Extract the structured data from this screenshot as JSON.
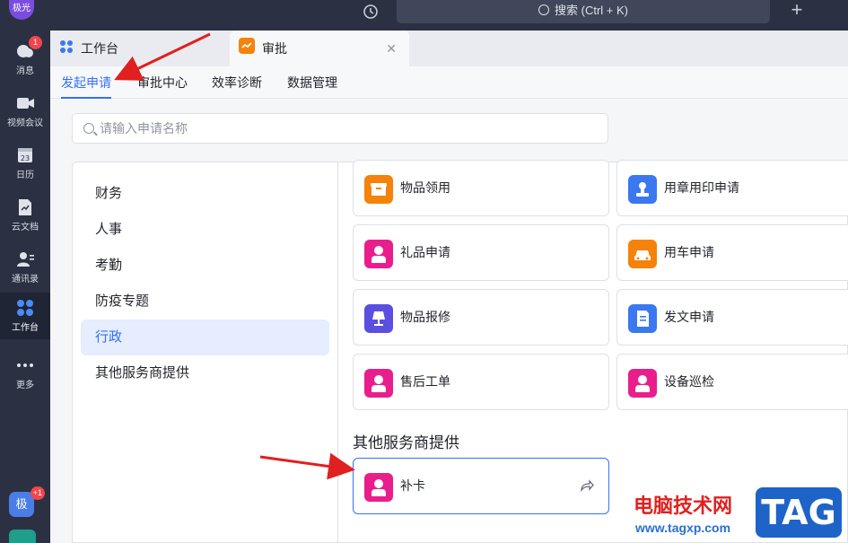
{
  "rail": {
    "top_avatar": "极光",
    "items": [
      {
        "label": "消息",
        "badge": "1",
        "icon": "chat-bubble-icon"
      },
      {
        "label": "视频会议",
        "icon": "video-camera-icon"
      },
      {
        "label": "日历",
        "day": "23",
        "icon": "calendar-icon"
      },
      {
        "label": "云文档",
        "icon": "cloud-document-icon"
      },
      {
        "label": "通讯录",
        "icon": "contacts-icon"
      },
      {
        "label": "工作台",
        "icon": "workbench-grid-icon"
      },
      {
        "label": "更多",
        "icon": "more-dots-icon"
      }
    ],
    "bottom_avatar": "极",
    "bottom_badge": "+1"
  },
  "titlebar": {
    "search_text": "搜索 (Ctrl + K)"
  },
  "tabs": [
    {
      "label": "工作台"
    },
    {
      "label": "审批"
    }
  ],
  "subnav": [
    "发起申请",
    "审批中心",
    "效率诊断",
    "数据管理"
  ],
  "search": {
    "placeholder": "请输入申请名称"
  },
  "categories": [
    "财务",
    "人事",
    "考勤",
    "防疫专题",
    "行政",
    "其他服务商提供"
  ],
  "cards": [
    {
      "label": "物品领用",
      "color": "#f5820a"
    },
    {
      "label": "用章用印申请",
      "color": "#3b78f0"
    },
    {
      "label": "礼品申请",
      "color": "#e91e8c"
    },
    {
      "label": "用车申请",
      "color": "#f5820a"
    },
    {
      "label": "物品报修",
      "color": "#5a4fe0"
    },
    {
      "label": "发文申请",
      "color": "#3b78f0"
    },
    {
      "label": "售后工单",
      "color": "#e91e8c"
    },
    {
      "label": "设备巡检",
      "color": "#e91e8c"
    }
  ],
  "other_section": {
    "title": "其他服务商提供",
    "card": {
      "label": "补卡",
      "color": "#e91e8c"
    }
  },
  "watermark": {
    "text": "电脑技术网",
    "url": "www.tagxp.com",
    "logo": "TAG"
  },
  "accent": "#3370ff"
}
